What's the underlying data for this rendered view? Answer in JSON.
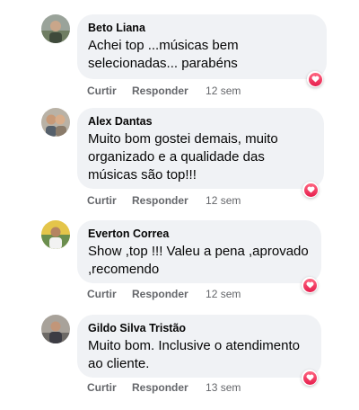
{
  "actions": {
    "like_label": "Curtir",
    "reply_label": "Responder"
  },
  "comments": [
    {
      "author": "Beto Liana",
      "lines": [
        "Achei top ...músicas bem",
        "selecionadas... parabéns"
      ],
      "time": "12 sem",
      "reaction": "heart-reaction-icon"
    },
    {
      "author": "Alex Dantas",
      "lines": [
        "Muito bom gostei demais, muito",
        "organizado e a qualidade das",
        "músicas são top!!!"
      ],
      "time": "12 sem",
      "reaction": "heart-reaction-icon"
    },
    {
      "author": "Everton Correa",
      "lines": [
        "Show ,top !!! Valeu a pena ,aprovado",
        ",recomendo"
      ],
      "time": "12 sem",
      "reaction": "heart-reaction-icon"
    },
    {
      "author": "Gildo Silva Tristão",
      "lines": [
        "Muito bom. Inclusive o atendimento",
        "ao cliente."
      ],
      "time": "13 sem",
      "reaction": "heart-reaction-icon"
    }
  ],
  "colors": {
    "bubble_bg": "#f0f2f5",
    "meta_text": "#65676b",
    "heart": "#f33e58"
  }
}
